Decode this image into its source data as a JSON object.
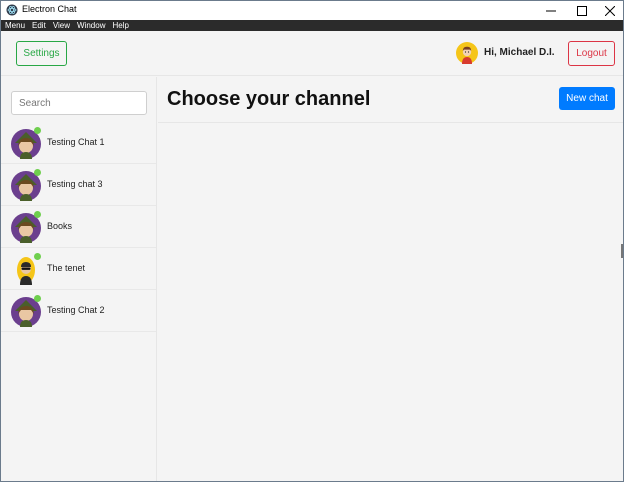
{
  "window": {
    "title": "Electron Chat"
  },
  "menu": [
    "Menu",
    "Edit",
    "View",
    "Window",
    "Help"
  ],
  "header": {
    "settings_label": "Settings",
    "greeting": "Hi, Michael D.I.",
    "logout_label": "Logout"
  },
  "sidebar": {
    "search_placeholder": "Search",
    "channels": [
      {
        "name": "Testing Chat 1",
        "avatar": "witch-avatar",
        "online": true
      },
      {
        "name": "Testing chat 3",
        "avatar": "witch-avatar",
        "online": true
      },
      {
        "name": "Books",
        "avatar": "witch-avatar",
        "online": true
      },
      {
        "name": "The tenet",
        "avatar": "agent-avatar",
        "online": true
      },
      {
        "name": "Testing Chat 2",
        "avatar": "witch-avatar",
        "online": true
      }
    ]
  },
  "main": {
    "title": "Choose your channel",
    "new_chat_label": "New chat"
  },
  "colors": {
    "success": "#28a745",
    "danger": "#dc3545",
    "primary": "#007bff",
    "online": "#6fcf4e",
    "menubar": "#2b2b2b"
  }
}
